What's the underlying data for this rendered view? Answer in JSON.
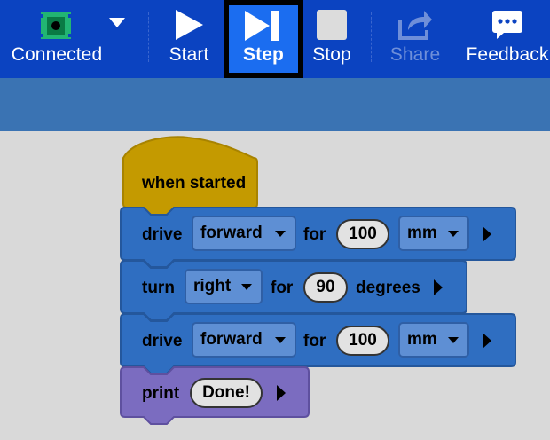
{
  "toolbar": {
    "connected_label": "Connected",
    "start_label": "Start",
    "step_label": "Step",
    "stop_label": "Stop",
    "share_label": "Share",
    "feedback_label": "Feedback",
    "accent_color": "#0b43c1",
    "active_color": "#1b6df0",
    "icons": [
      "robot-connected-icon",
      "chevron-down-icon",
      "play-icon",
      "step-icon",
      "stop-icon",
      "share-icon",
      "feedback-icon"
    ]
  },
  "blocks": {
    "hat": {
      "label": "when started",
      "color": "#c49a00"
    },
    "drive1": {
      "label": "drive",
      "direction": "forward",
      "for_label": "for",
      "distance": "100",
      "unit": "mm",
      "color": "#2f6ec1"
    },
    "turn": {
      "label": "turn",
      "direction": "right",
      "for_label": "for",
      "angle": "90",
      "unit": "degrees"
    },
    "drive2": {
      "label": "drive",
      "direction": "forward",
      "for_label": "for",
      "distance": "100",
      "unit": "mm"
    },
    "print": {
      "label": "print",
      "value": "Done!",
      "color": "#7b6cc0"
    }
  }
}
